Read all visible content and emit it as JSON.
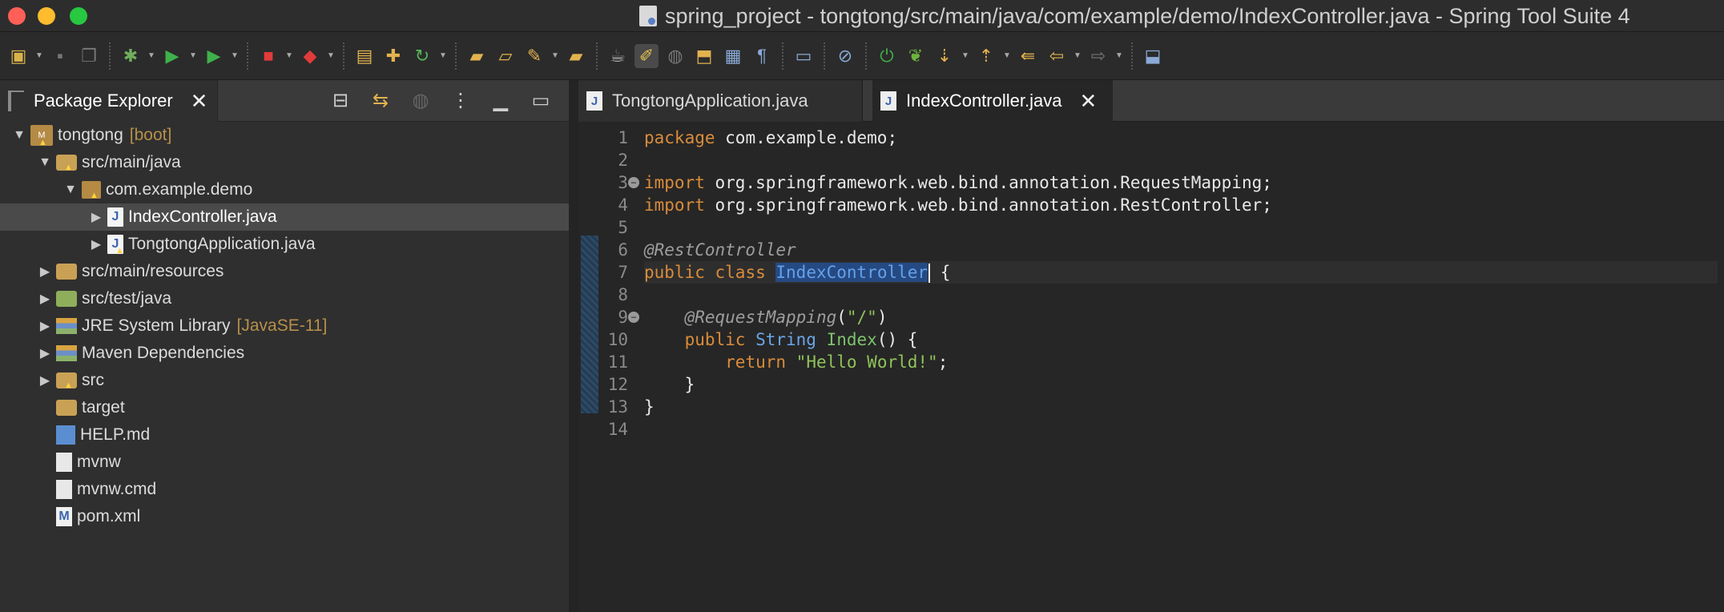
{
  "window": {
    "title": "spring_project - tongtong/src/main/java/com/example/demo/IndexController.java - Spring Tool Suite 4"
  },
  "toolbar": {
    "icons": [
      "new-icon",
      "save-icon",
      "save-all-icon",
      "debug-icon",
      "run-icon",
      "run-config-icon",
      "stop-icon",
      "relaunch-icon",
      "open-project-icon",
      "new-package-icon",
      "refresh-icon",
      "open-folder-icon",
      "open-file-icon",
      "build-icon",
      "open-type-icon",
      "coffee-icon",
      "highlight-icon",
      "search-icon",
      "task-icon",
      "block-select-icon",
      "show-whitespace-icon",
      "comment-icon",
      "skip-breakpoints-icon",
      "boot-dashboard-icon",
      "spring-icon",
      "next-annotation-icon",
      "prev-annotation-icon",
      "last-edit-icon",
      "back-icon",
      "forward-icon",
      "pin-icon"
    ]
  },
  "package_explorer": {
    "tab_label": "Package Explorer",
    "tree": [
      {
        "label": "tongtong",
        "decor": "[boot]",
        "expanded": "true"
      },
      {
        "label": "src/main/java",
        "decor": "",
        "expanded": "true"
      },
      {
        "label": "com.example.demo",
        "decor": "",
        "expanded": "true"
      },
      {
        "label": "IndexController.java",
        "decor": "",
        "expanded": "false"
      },
      {
        "label": "TongtongApplication.java",
        "decor": "",
        "expanded": "false"
      },
      {
        "label": "src/main/resources",
        "decor": "",
        "expanded": "false"
      },
      {
        "label": "src/test/java",
        "decor": "",
        "expanded": "false"
      },
      {
        "label": "JRE System Library",
        "decor": "[JavaSE-11]",
        "expanded": "false"
      },
      {
        "label": "Maven Dependencies",
        "decor": "",
        "expanded": "false"
      },
      {
        "label": "src",
        "decor": "",
        "expanded": "false"
      },
      {
        "label": "target",
        "decor": "",
        "expanded": ""
      },
      {
        "label": "HELP.md",
        "decor": "",
        "expanded": ""
      },
      {
        "label": "mvnw",
        "decor": "",
        "expanded": ""
      },
      {
        "label": "mvnw.cmd",
        "decor": "",
        "expanded": ""
      },
      {
        "label": "pom.xml",
        "decor": "",
        "expanded": ""
      }
    ],
    "selected": "IndexController.java"
  },
  "editor": {
    "tabs": [
      {
        "label": "TongtongApplication.java"
      },
      {
        "label": "IndexController.java"
      }
    ],
    "active_tab": "IndexController.java",
    "line_numbers": [
      "1",
      "2",
      "3",
      "4",
      "5",
      "6",
      "7",
      "8",
      "9",
      "10",
      "11",
      "12",
      "13",
      "14"
    ],
    "code": {
      "l1_kw": "package",
      "l1_rest": " com.example.demo;",
      "l3_kw": "import",
      "l3_rest": " org.springframework.web.bind.annotation.RequestMapping;",
      "l4_kw": "import",
      "l4_rest": " org.springframework.web.bind.annotation.RestController;",
      "l6_ann": "@RestController",
      "l7_kw1": "public",
      "l7_kw2": "class",
      "l7_sel": "IndexController",
      "l7_rest": " {",
      "l9_ann": "@RequestMapping",
      "l9_paren_open": "(",
      "l9_str": "\"/\"",
      "l9_paren_close": ")",
      "l10_kw": "public",
      "l10_type": "String",
      "l10_meth": "Index",
      "l10_rest": "() {",
      "l11_kw": "return",
      "l11_str": "\"Hello World!\"",
      "l11_rest": ";",
      "l12": "}",
      "l13": "}"
    }
  }
}
